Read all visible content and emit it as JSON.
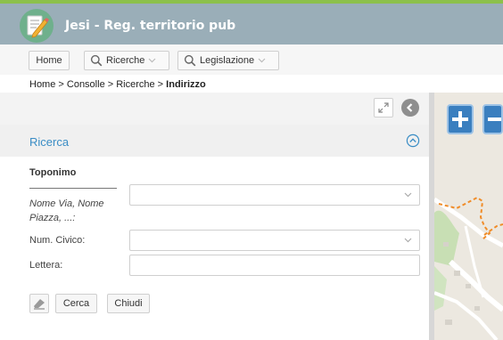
{
  "app": {
    "title": "Jesi - Reg. territorio pub"
  },
  "toolbar": {
    "home_label": "Home",
    "ricerche_label": "Ricerche",
    "legislazione_label": "Legislazione"
  },
  "breadcrumb": {
    "path": "Home > Consolle > Ricerche > ",
    "current": "Indirizzo"
  },
  "panel": {
    "section_title": "Ricerca"
  },
  "form": {
    "group_title": "Toponimo",
    "nome_label_line1": "Nome Via, Nome",
    "nome_label_line2": "Piazza, ...:",
    "nome_value": "",
    "civico_label": "Num. Civico:",
    "civico_value": "",
    "lettera_label": "Lettera:",
    "lettera_value": ""
  },
  "actions": {
    "cerca_label": "Cerca",
    "chiudi_label": "Chiudi"
  },
  "colors": {
    "accent": "#3a8dc5",
    "header_bg": "#9aaeb8",
    "map_button": "#3a7fbf",
    "route_dashes": "#f08c28"
  },
  "icons": {
    "logo": "document-pen-icon",
    "search": "magnifier-icon",
    "dropdown": "chevron-down-icon",
    "expand": "expand-arrows-icon",
    "back": "back-circle-icon",
    "collapse": "chevron-up-circle-icon",
    "eraser": "eraser-icon",
    "zoom_in": "plus-icon",
    "zoom_out": "minus-icon"
  }
}
